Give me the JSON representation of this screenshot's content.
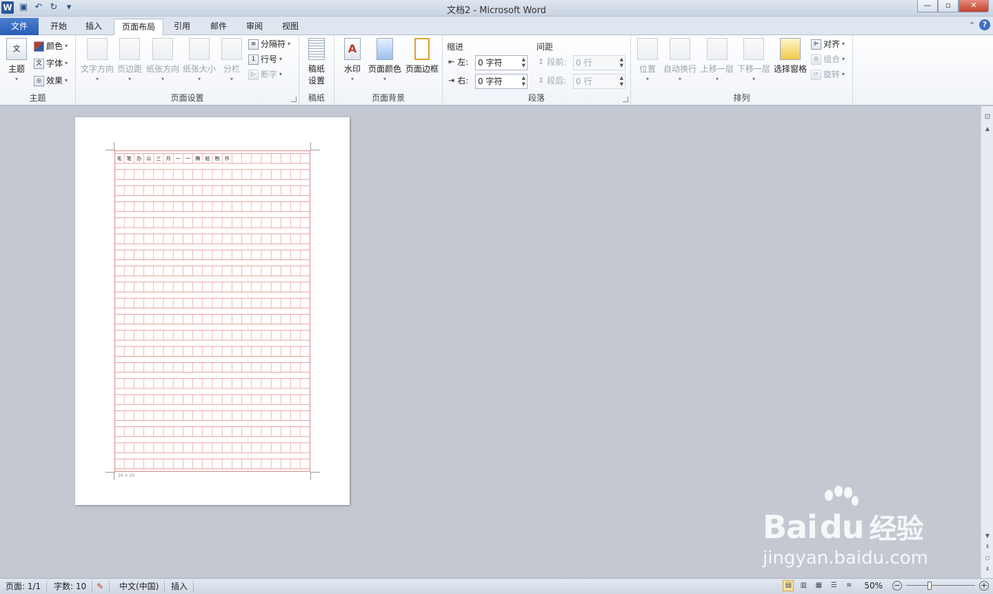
{
  "window": {
    "title": "文档2 - Microsoft Word",
    "quick_access": [
      "save-icon",
      "undo-icon",
      "redo-icon",
      "customize-icon"
    ]
  },
  "tabs": [
    {
      "label": "文件"
    },
    {
      "label": "开始"
    },
    {
      "label": "插入"
    },
    {
      "label": "页面布局"
    },
    {
      "label": "引用"
    },
    {
      "label": "邮件"
    },
    {
      "label": "审阅"
    },
    {
      "label": "视图"
    }
  ],
  "ribbon": {
    "theme": {
      "label": "主题",
      "big": "主题",
      "colors": "颜色",
      "fonts": "字体",
      "effects": "效果"
    },
    "page_setup": {
      "label": "页面设置",
      "text_direction": "文字方向",
      "margins": "页边距",
      "orientation": "纸张方向",
      "size": "纸张大小",
      "columns": "分栏",
      "breaks": "分隔符",
      "line_numbers": "行号",
      "hyphenation": "断字"
    },
    "manuscript": {
      "label": "稿纸",
      "button_line1": "稿纸",
      "button_line2": "设置"
    },
    "page_background": {
      "label": "页面背景",
      "watermark": "水印",
      "page_color": "页面颜色",
      "page_borders": "页面边框"
    },
    "paragraph": {
      "label": "段落",
      "indent_title": "缩进",
      "spacing_title": "间距",
      "indent_left_label": "左:",
      "indent_right_label": "右:",
      "indent_left_value": "0 字符",
      "indent_right_value": "0 字符",
      "before_label": "段前:",
      "after_label": "段后:",
      "before_value": "0 行",
      "after_value": "0 行"
    },
    "arrange": {
      "label": "排列",
      "position": "位置",
      "wrap_text": "自动换行",
      "bring_forward": "上移一层",
      "send_backward": "下移一层",
      "selection_pane": "选择窗格",
      "align": "对齐",
      "group": "组合",
      "rotate": "旋转"
    }
  },
  "document": {
    "grid_rows": 20,
    "grid_cols": 20,
    "first_line_chars": [
      "毛",
      "笔",
      "办",
      "公",
      "三",
      "月",
      "一",
      "一",
      "稿",
      "纸",
      "制",
      "作"
    ],
    "footer_note": "20 × 20"
  },
  "statusbar": {
    "page": "页面: 1/1",
    "words": "字数: 10",
    "language": "中文(中国)",
    "mode": "插入",
    "zoom": "50%"
  },
  "watermark": {
    "brand": "Bai",
    "brand_cn": "经验",
    "url": "jingyan.baidu.com"
  }
}
